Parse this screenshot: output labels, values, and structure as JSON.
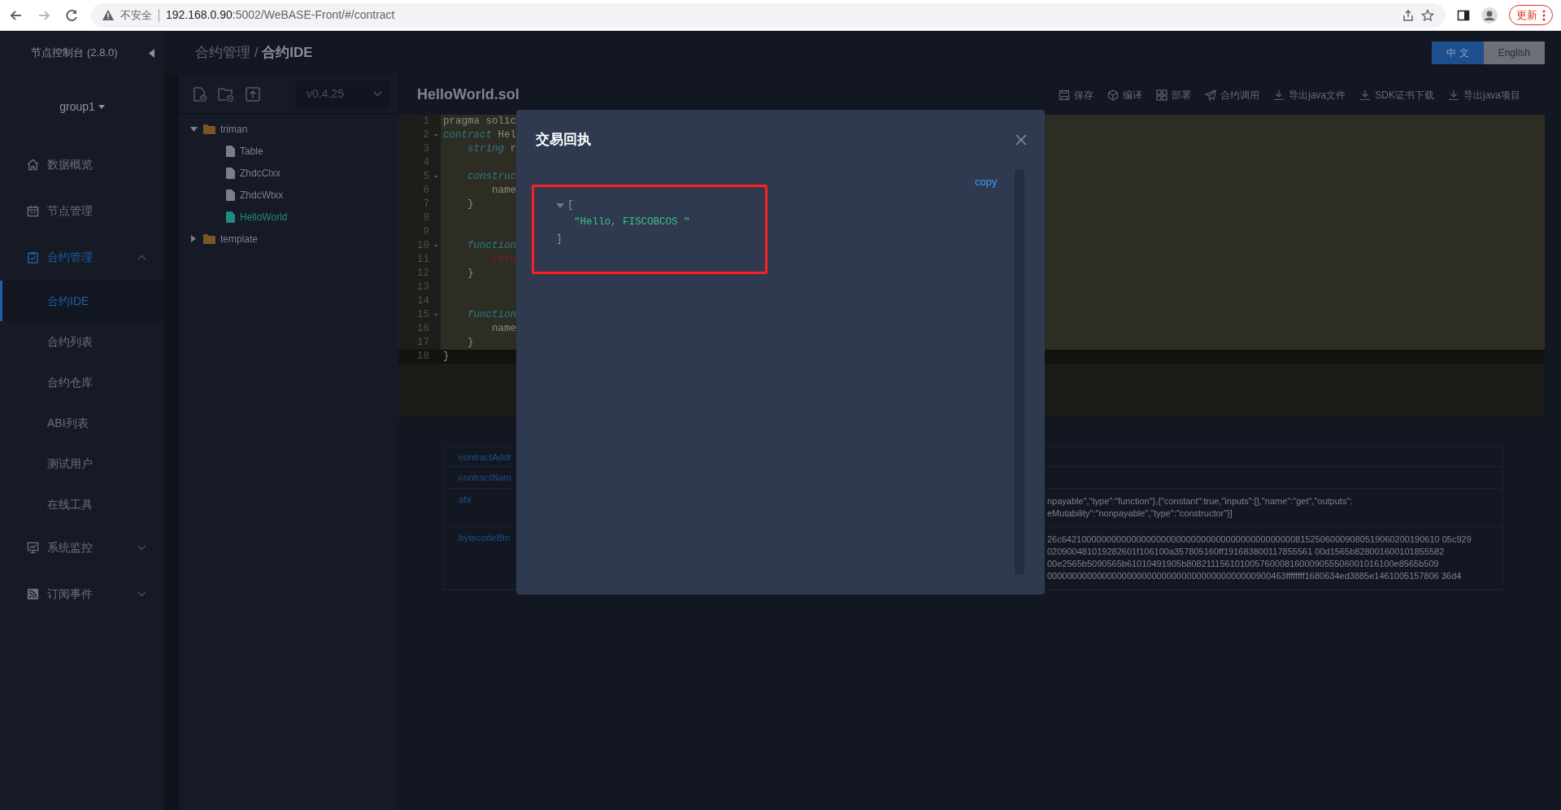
{
  "browser": {
    "security": "不安全",
    "url_host": "192.168.0.90",
    "url_path": ":5002/WeBASE-Front/#/contract",
    "update_label": "更新"
  },
  "sidebar": {
    "title": "节点控制台 (2.8.0)",
    "group": "group1",
    "items": [
      {
        "label": "数据概览",
        "kind": "link",
        "selected": false
      },
      {
        "label": "节点管理",
        "kind": "link",
        "selected": false
      },
      {
        "label": "合约管理",
        "kind": "group",
        "selected": true,
        "expanded": true,
        "children": [
          {
            "label": "合约IDE",
            "selected": true
          },
          {
            "label": "合约列表",
            "selected": false
          },
          {
            "label": "合约仓库",
            "selected": false
          },
          {
            "label": "ABI列表",
            "selected": false
          },
          {
            "label": "测试用户",
            "selected": false
          },
          {
            "label": "在线工具",
            "selected": false
          }
        ]
      },
      {
        "label": "系统监控",
        "kind": "group",
        "selected": false,
        "expanded": false
      },
      {
        "label": "订阅事件",
        "kind": "group",
        "selected": false,
        "expanded": false
      }
    ]
  },
  "header": {
    "breadcrumb_parent": "合约管理",
    "breadcrumb_separator": "/",
    "breadcrumb_current": "合约IDE",
    "languages": [
      {
        "label": "中 文",
        "selected": true
      },
      {
        "label": "English",
        "selected": false
      }
    ]
  },
  "ide": {
    "compiler_version": "v0.4.25",
    "file_title": "HelloWorld.sol",
    "actions": [
      "保存",
      "编译",
      "部署",
      "合约调用",
      "导出java文件",
      "SDK证书下载",
      "导出java项目"
    ],
    "file_tree": [
      {
        "name": "triman",
        "kind": "folder",
        "expanded": true,
        "children": [
          {
            "name": "Table",
            "kind": "file",
            "selected": false
          },
          {
            "name": "ZhdcClxx",
            "kind": "file",
            "selected": false
          },
          {
            "name": "ZhdcWtxx",
            "kind": "file",
            "selected": false
          },
          {
            "name": "HelloWorld",
            "kind": "file",
            "selected": true
          }
        ]
      },
      {
        "name": "template",
        "kind": "folder",
        "expanded": false
      }
    ],
    "code_lines": [
      {
        "number": "1",
        "foldable": false,
        "selected": true,
        "tokens": [
          {
            "text": "pragma solic",
            "kind": "plain"
          }
        ]
      },
      {
        "number": "2",
        "foldable": true,
        "selected": true,
        "tokens": [
          {
            "text": "contract",
            "kind": "keyword"
          },
          {
            "text": " Hel",
            "kind": "plain"
          }
        ]
      },
      {
        "number": "3",
        "foldable": false,
        "selected": true,
        "tokens": [
          {
            "text": "    string",
            "kind": "keyword"
          },
          {
            "text": " r",
            "kind": "plain"
          }
        ]
      },
      {
        "number": "4",
        "foldable": false,
        "selected": true
      },
      {
        "number": "5",
        "foldable": true,
        "selected": true,
        "tokens": [
          {
            "text": "    construc",
            "kind": "keyword"
          }
        ]
      },
      {
        "number": "6",
        "foldable": false,
        "selected": true,
        "tokens": [
          {
            "text": "        name",
            "kind": "plain"
          }
        ]
      },
      {
        "number": "7",
        "foldable": false,
        "selected": true,
        "tokens": [
          {
            "text": "    }",
            "kind": "plain"
          }
        ]
      },
      {
        "number": "8",
        "foldable": false,
        "selected": true
      },
      {
        "number": "9",
        "foldable": false,
        "selected": true
      },
      {
        "number": "10",
        "foldable": true,
        "selected": true,
        "tokens": [
          {
            "text": "    function",
            "kind": "keyword"
          }
        ]
      },
      {
        "number": "11",
        "foldable": false,
        "selected": true,
        "tokens": [
          {
            "text": "        retu",
            "kind": "control"
          }
        ]
      },
      {
        "number": "12",
        "foldable": false,
        "selected": true,
        "tokens": [
          {
            "text": "    }",
            "kind": "plain"
          }
        ]
      },
      {
        "number": "13",
        "foldable": false,
        "selected": true
      },
      {
        "number": "14",
        "foldable": false,
        "selected": true
      },
      {
        "number": "15",
        "foldable": true,
        "selected": true,
        "tokens": [
          {
            "text": "    function",
            "kind": "keyword"
          }
        ]
      },
      {
        "number": "16",
        "foldable": false,
        "selected": true,
        "tokens": [
          {
            "text": "        name",
            "kind": "plain"
          }
        ]
      },
      {
        "number": "17",
        "foldable": false,
        "selected": true,
        "tokens": [
          {
            "text": "    }",
            "kind": "plain"
          }
        ]
      },
      {
        "number": "18",
        "foldable": false,
        "selected": false,
        "tokens": [
          {
            "text": "}",
            "kind": "plain"
          }
        ]
      }
    ]
  },
  "contract_info": {
    "rows": [
      {
        "label": "contractAddr"
      },
      {
        "label": "contractNam"
      },
      {
        "label": "abi",
        "value_lines": [
          "npayable\",\"type\":\"function\"},{\"constant\":true,\"inputs\":[],\"name\":\"get\",\"outputs\":",
          "eMutability\":\"nonpayable\",\"type\":\"constructor\"}]"
        ]
      },
      {
        "label": "bytecodeBin",
        "value_lines": [
          "26c6421000000000000000000000000000000000000000000081525060009080519060200190610 05c929",
          "020900481019282601f106100a357805160ff191683800117855561 00d1565b828001600101855582",
          "00e2565b5090565b61010491905b808211156101005760008160009055506001016100e8565b509",
          "000000000000000000000000000000000000000000900463ffffffff1680634ed3885e1461005157806 36d4"
        ]
      }
    ]
  },
  "receipt_dialog": {
    "title": "交易回执",
    "copy_label": "copy",
    "expanded": true,
    "json_open": "[",
    "json_items": [
      "\"Hello, FISCOBCOS \""
    ],
    "json_close": "]"
  }
}
